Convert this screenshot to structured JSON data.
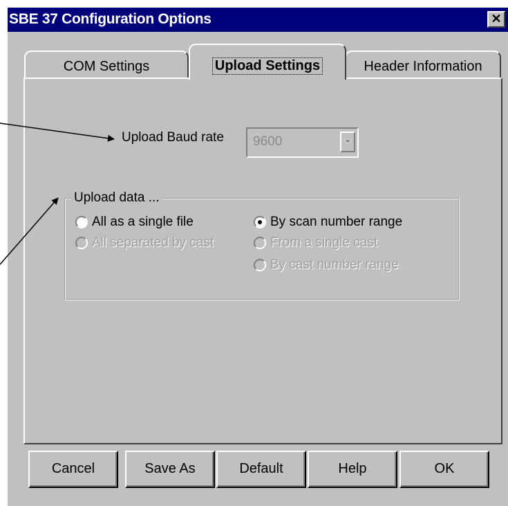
{
  "window": {
    "title": "SBE 37 Configuration Options",
    "close_glyph": "✕"
  },
  "tabs": [
    {
      "label": "COM Settings",
      "active": false
    },
    {
      "label": "Upload Settings",
      "active": true
    },
    {
      "label": "Header Information",
      "active": false
    }
  ],
  "upload_settings": {
    "baud_label": "Upload Baud rate",
    "baud_value": "9600",
    "group_title": "Upload data ...",
    "options": [
      {
        "label": "All as a single file",
        "selected": false,
        "enabled": true
      },
      {
        "label": "All separated by cast",
        "selected": false,
        "enabled": false
      },
      {
        "label": "By scan number range",
        "selected": true,
        "enabled": true
      },
      {
        "label": "From a single cast",
        "selected": false,
        "enabled": false
      },
      {
        "label": "By cast number range",
        "selected": false,
        "enabled": false
      }
    ]
  },
  "buttons": {
    "cancel": "Cancel",
    "save_as": "Save As",
    "default": "Default",
    "help": "Help",
    "ok": "OK"
  },
  "colors": {
    "title_bar": "#00007b",
    "face": "#c0c0c0",
    "disabled_text": "#a0a0a0"
  }
}
